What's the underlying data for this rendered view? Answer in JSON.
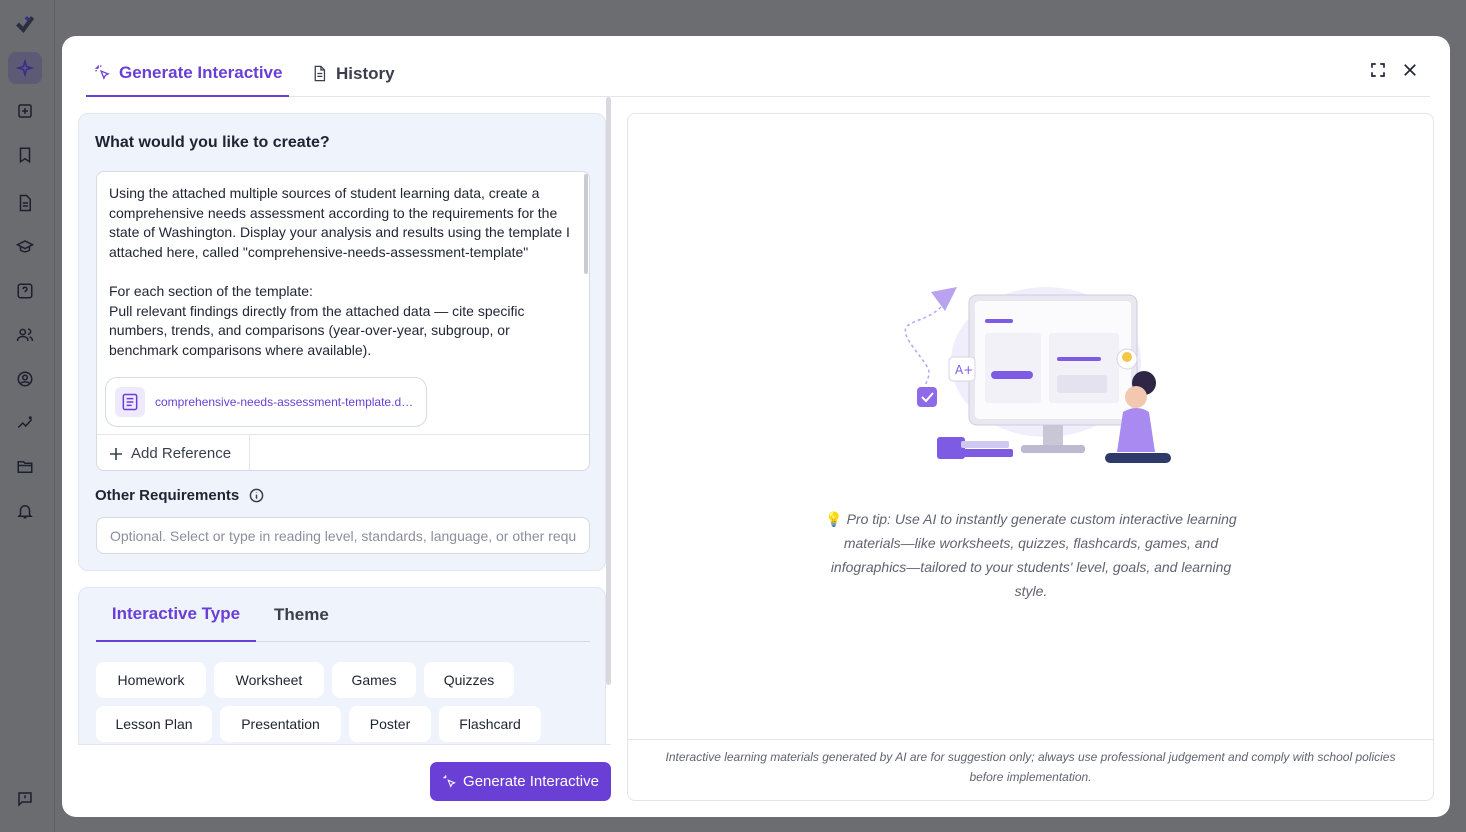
{
  "sidebar": {
    "icons": [
      "logo-icon",
      "ai-sparkle-icon",
      "add-note-icon",
      "bookmark-icon",
      "document-icon",
      "graduation-cap-icon",
      "help-square-icon",
      "users-icon",
      "account-circle-icon",
      "analytics-icon",
      "folder-icon",
      "bell-icon",
      "feedback-icon"
    ]
  },
  "modal": {
    "tabs": [
      {
        "label": "Generate Interactive",
        "icon": "magic-cursor-icon",
        "active": true
      },
      {
        "label": "History",
        "icon": "document-icon",
        "active": false
      }
    ]
  },
  "form": {
    "question_label": "What would you like to create?",
    "prompt_text": "Using the attached multiple sources of student learning data, create a comprehensive needs assessment according to the requirements for the state of Washington. Display your analysis and results using the template I attached here, called \"comprehensive-needs-assessment-template\"\n\nFor each section of the template:\nPull relevant findings directly from the attached data — cite specific numbers, trends, and comparisons (year-over-year, subgroup, or benchmark comparisons where available).",
    "attachment_name": "comprehensive-needs-assessment-template.docx",
    "add_reference_label": "Add Reference",
    "other_requirements_label": "Other Requirements",
    "other_requirements_placeholder": "Optional. Select or type in reading level, standards, language, or other requirements"
  },
  "type_tabs": [
    {
      "label": "Interactive Type",
      "active": true
    },
    {
      "label": "Theme",
      "active": false
    }
  ],
  "interactive_types": [
    "Homework",
    "Worksheet",
    "Games",
    "Quizzes",
    "Lesson Plan",
    "Presentation",
    "Poster",
    "Flashcard"
  ],
  "generate_button_label": "Generate Interactive",
  "preview": {
    "pro_tip": "Pro tip: Use AI to instantly generate custom interactive learning materials—like worksheets, quizzes, flashcards, games, and infographics—tailored to your students' level, goals, and learning style.",
    "disclaimer": "Interactive learning materials generated by AI are for suggestion only; always use professional judgement and comply with school policies before implementation."
  },
  "colors": {
    "accent": "#6a3fd6",
    "panel_bg": "#eef3fc",
    "backdrop": "#6b6d70"
  }
}
